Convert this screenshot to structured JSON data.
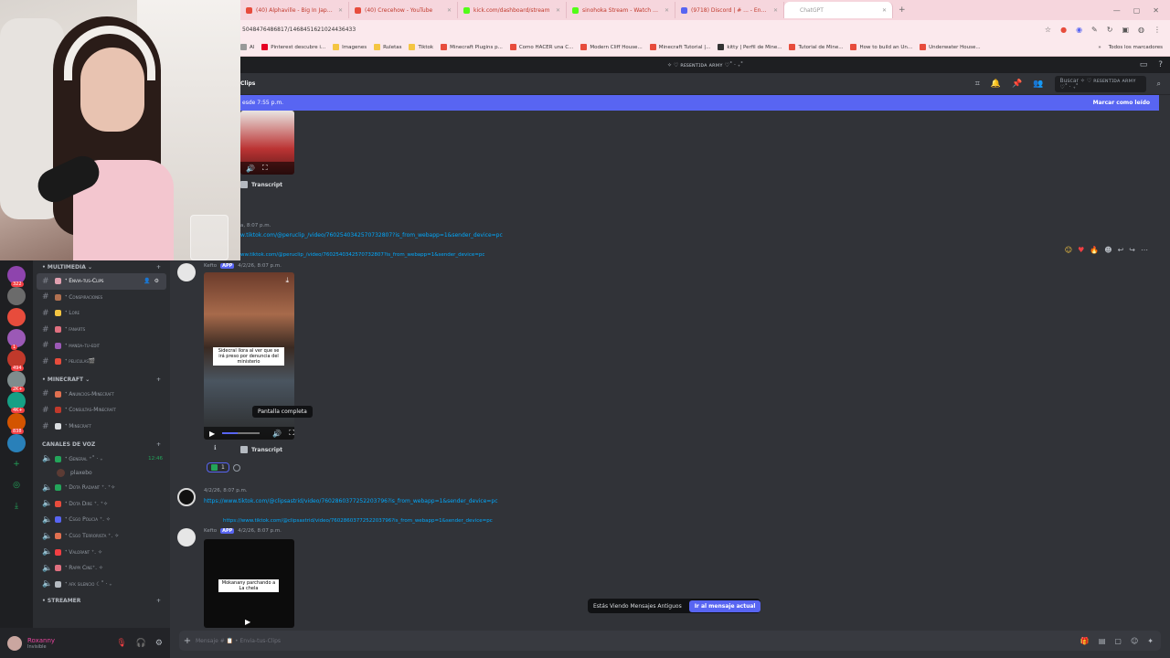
{
  "browser": {
    "tabs": [
      {
        "label": "(40) Alphaville - Big In Japan (...",
        "color": "#e74c3c"
      },
      {
        "label": "(40) Crecehow - YouTube",
        "color": "#e74c3c"
      },
      {
        "label": "kick.com/dashboard/stream",
        "color": "#53fc18"
      },
      {
        "label": "sinohoka Stream - Watch Live ...",
        "color": "#53fc18"
      },
      {
        "label": "(9718) Discord | # ... - Envi...",
        "color": "#5865f2"
      },
      {
        "label": "ChatGPT",
        "color": "#ffffff"
      }
    ],
    "url": "5048476486817/1468451621024436433",
    "bookmarks": [
      {
        "label": "Al",
        "color": "#999999"
      },
      {
        "label": "Pinterest descubre i...",
        "color": "#e60023"
      },
      {
        "label": "Imagenes",
        "color": "#f4c542"
      },
      {
        "label": "Ruletas",
        "color": "#f4c542"
      },
      {
        "label": "Tiktok",
        "color": "#f4c542"
      },
      {
        "label": "Minecraft Plugins p...",
        "color": "#e74c3c"
      },
      {
        "label": "Como HACER una C...",
        "color": "#e74c3c"
      },
      {
        "label": "Modern Cliff House...",
        "color": "#e74c3c"
      },
      {
        "label": "Minecraft Tutorial |...",
        "color": "#e74c3c"
      },
      {
        "label": "kitty | Perfil de Mine...",
        "color": "#333333"
      },
      {
        "label": "Tutorial de Mine...",
        "color": "#e74c3c"
      },
      {
        "label": "How to build an Un...",
        "color": "#e74c3c"
      },
      {
        "label": "Underwater House...",
        "color": "#e74c3c"
      }
    ],
    "all_bookmarks": "Todos los marcadores"
  },
  "discord": {
    "server_title": "✧ ♡ ʀᴇsᴇɴᴛɪᴅᴀ ᴀʀᴍʏ ♡˚ ‧ ₊˚",
    "channel_title": "Clips",
    "search_placeholder": "Buscar ✧ ♡ ʀᴇsᴇɴᴛɪᴅᴀ ᴀʀᴍʏ ♡˚ ‧ ₊˚",
    "newbar_text": "esde 7:55 p.m.",
    "newbar_action": "Marcar como leído",
    "servers": [
      {
        "color": "#8e44ad",
        "badge": "322"
      },
      {
        "color": "#6b6b6b",
        "badge": ""
      },
      {
        "color": "#e74c3c",
        "badge": ""
      },
      {
        "color": "#9b59b6",
        "badge": "1"
      },
      {
        "color": "#c0392b",
        "badge": "494"
      },
      {
        "color": "#7f8c8d",
        "badge": "2K+"
      },
      {
        "color": "#16a085",
        "badge": "4K+"
      },
      {
        "color": "#d35400",
        "badge": "838"
      },
      {
        "color": "#2980b9",
        "badge": ""
      }
    ],
    "categories": {
      "multimedia": "• MULTIMEDIA",
      "minecraft": "• MINECRAFT",
      "voz": "CANALES DE VOZ",
      "streamer": "• STREAMER"
    },
    "multimedia_channels": [
      {
        "label": "ᐩ Envia-tus-Clips",
        "color": "#e0a0b0",
        "selected": true
      },
      {
        "label": "ᐩ Conspiraciones",
        "color": "#b07050",
        "selected": false
      },
      {
        "label": "ᐩ Lore",
        "color": "#f4c542",
        "selected": false
      },
      {
        "label": "ᐩ fanarts",
        "color": "#e07080",
        "selected": false
      },
      {
        "label": "ᐩ manda-tu-edit",
        "color": "#9b59b6",
        "selected": false
      },
      {
        "label": "ᐩ peliculas🎬",
        "color": "#e74c3c",
        "selected": false
      }
    ],
    "minecraft_channels": [
      {
        "label": "ᐩ Anuncios-Minecraft",
        "color": "#e07050"
      },
      {
        "label": "ᐩ Consultas-Minecraft",
        "color": "#c0392b"
      },
      {
        "label": "ᐩ Minecraft",
        "color": "#dbdee1"
      }
    ],
    "voice_channels": [
      {
        "label": "ᐩ General ⁺˚ ‧ ₊",
        "color": "#23a55a",
        "time": "12:46"
      },
      {
        "label": "ᐩ Dota Radiant ⁺. ⁺✧",
        "color": "#23a55a",
        "time": ""
      },
      {
        "label": "ᐩ Dota Dire ⁺. ⁺✧",
        "color": "#e74c3c",
        "time": ""
      },
      {
        "label": "ᐩ Csgo Policia ⁺. ✧",
        "color": "#5865f2",
        "time": ""
      },
      {
        "label": "ᐩ Csgo Terrorista ⁺. ✧",
        "color": "#e07050",
        "time": ""
      },
      {
        "label": "ᐩ Valorant ⁺. ✧",
        "color": "#f23f43",
        "time": ""
      },
      {
        "label": "ᐩ Rappi Cine⁺. ✧",
        "color": "#e07080",
        "time": ""
      },
      {
        "label": "ᐩ afk silencio ☾˚ ‧ ₊",
        "color": "#b5bac1",
        "time": ""
      }
    ],
    "voice_user": "plaxebo",
    "user": {
      "name": "Roxanny",
      "status": "Invisible"
    }
  },
  "messages": {
    "top_transcript": "Transcript",
    "msg1_time": "a, 8:07 p.m.",
    "msg1_link": "w.tiktok.com/@peruclip_/video/7602540342570732807?is_from_webapp=1&sender_device=pc",
    "msg1_reply_link": "ww.tiktok.com/@peruclip_/video/7602540342570732807?is_from_webapp=1&sender_device=pc",
    "msg1_author": "Kefto",
    "app_tag": "APP",
    "msg1_date": "4/2/26, 8:07 p.m.",
    "video_caption": "Sidecral llora al ver que se irá preso por denuncia del ministerio",
    "tooltip": "Pantalla completa",
    "transcript": "Transcript",
    "reaction_count": "1",
    "msg2_date": "4/2/26, 8:07 p.m.",
    "msg2_link": "https://www.tiktok.com/@clipsastrid/video/7602860377252203796?is_from_webapp=1&sender_device=pc",
    "msg2_reply_link": "https://www.tiktok.com/@clipsastrid/video/7602860377252203796?is_from_webapp=1&sender_device=pc",
    "msg2_author": "Kefto",
    "msg2_app_date": "4/2/26, 8:07 p.m.",
    "video2_caption": "Mokanany parchando a La chela"
  },
  "banner": {
    "text": "Estás Viendo Mensajes Antiguos",
    "action": "Ir al mensaje actual"
  },
  "composer": {
    "placeholder": "Mensaje # 📋 • Envia-tus-Clips"
  }
}
